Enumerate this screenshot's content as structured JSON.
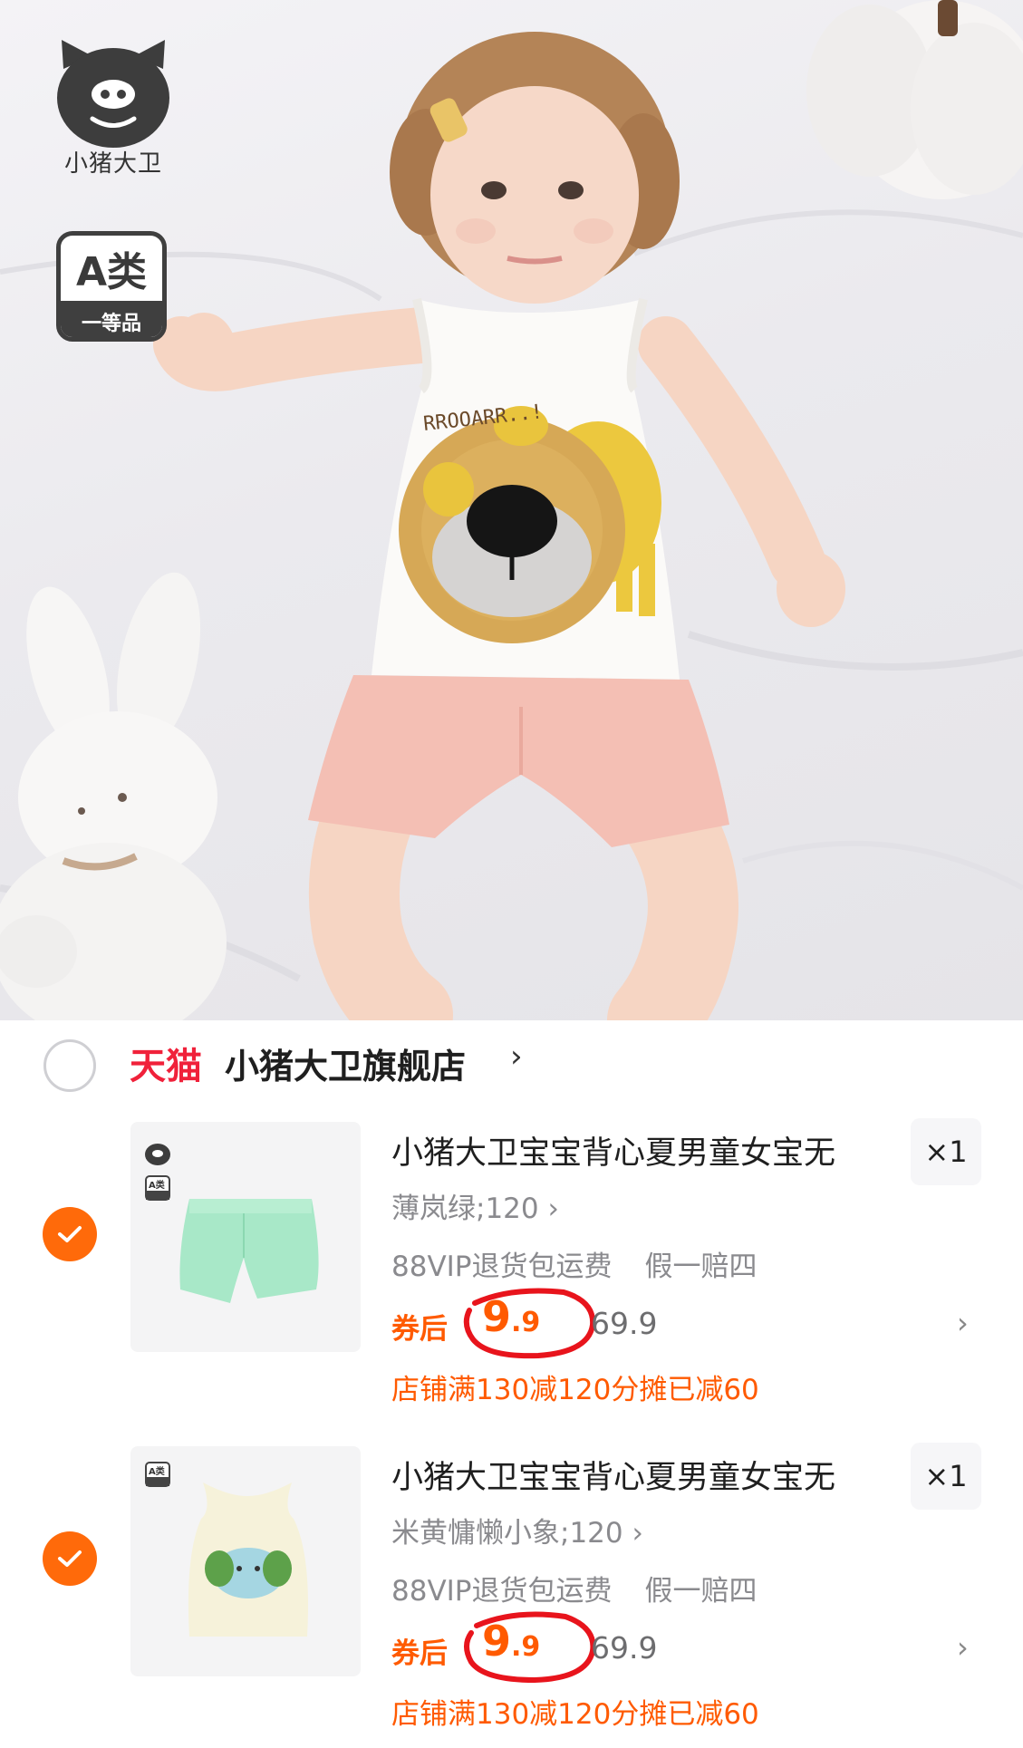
{
  "hero": {
    "brand_name": "小猪大卫",
    "grade_badge": {
      "top": "A类",
      "bottom": "一等品"
    },
    "shirt_print_text": "RROOARR..!",
    "icons": [
      "pig-logo-icon",
      "lion-print",
      "bunny-toy",
      "pumpkin-pillow"
    ]
  },
  "store": {
    "platform": "天猫",
    "name": "小猪大卫旗舰店",
    "chevron": "›",
    "selected": false
  },
  "items": [
    {
      "title": "小猪大卫宝宝背心夏男童女宝无",
      "sku": "薄岚绿;120 ›",
      "quantity": "×1",
      "services": [
        "88VIP退货包运费",
        "假一赔四"
      ],
      "after_coupon_label": "券后",
      "price_int": "9",
      "price_dec": ".9",
      "original_price": "69.9",
      "promo": "店铺满130减120分摊已减60",
      "selected": true,
      "thumb_product": "mint-green-shorts",
      "thumb_logos": [
        "pig-logo-mini",
        "grade-badge-mini"
      ],
      "thumb_logo_text": "A类"
    },
    {
      "title": "小猪大卫宝宝背心夏男童女宝无",
      "sku": "米黄慵懒小象;120 ›",
      "quantity": "×1",
      "services": [
        "88VIP退货包运费",
        "假一赔四"
      ],
      "after_coupon_label": "券后",
      "price_int": "9",
      "price_dec": ".9",
      "original_price": "69.9",
      "promo": "店铺满130减120分摊已减60",
      "selected": true,
      "thumb_product": "cream-elephant-vest",
      "thumb_logos": [
        "grade-badge-mini"
      ],
      "thumb_logo_text": "A类"
    }
  ],
  "colors": {
    "accent_orange": "#ff5a00",
    "check_orange": "#ff6a0a",
    "tmall_red": "#f0213a",
    "annotation_red": "#e8141c"
  }
}
